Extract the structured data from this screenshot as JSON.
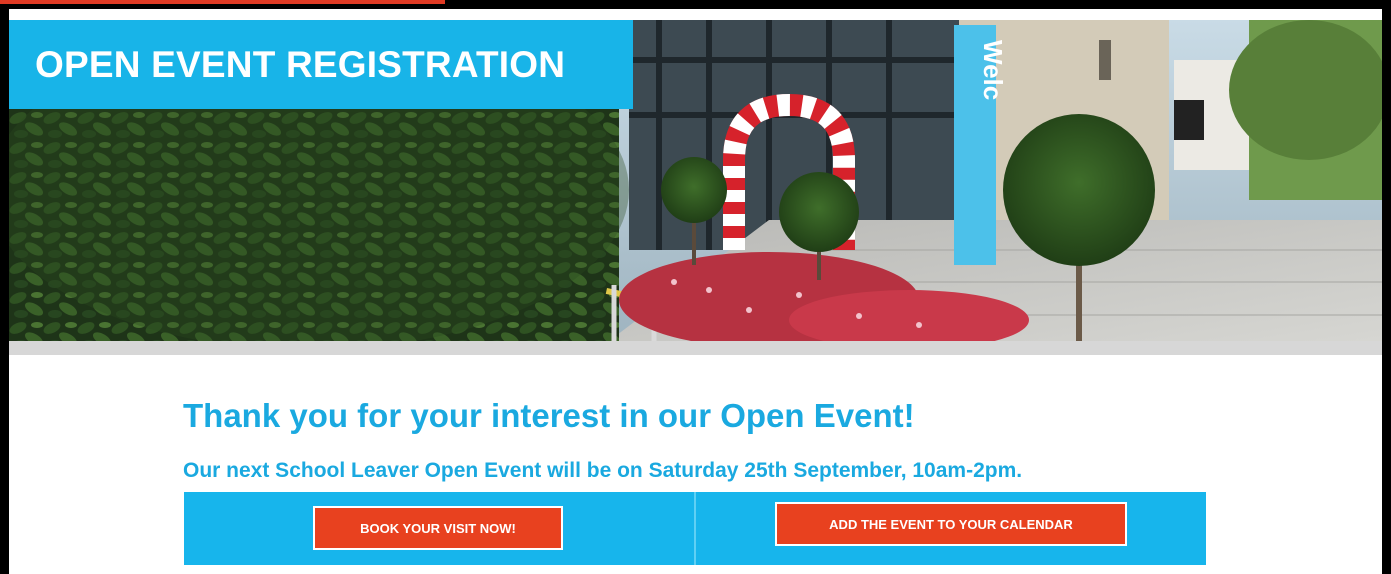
{
  "page": {
    "title_banner": "OPEN EVENT REGISTRATION",
    "headline": "Thank you for your interest in our Open Event!",
    "subline": "Our next School Leaver Open Event will be on Saturday 25th September, 10am-2pm.",
    "book_button": "BOOK YOUR VISIT NOW!",
    "calendar_button": "ADD THE EVENT TO YOUR CALENDAR",
    "banner_flag_text": "Welc"
  },
  "progress": {
    "fraction": 0.32
  },
  "colors": {
    "accent_blue": "#18b4e8",
    "button_red": "#e8411f",
    "progress_red": "#e03a24",
    "text_blue": "#1aa9e0"
  }
}
